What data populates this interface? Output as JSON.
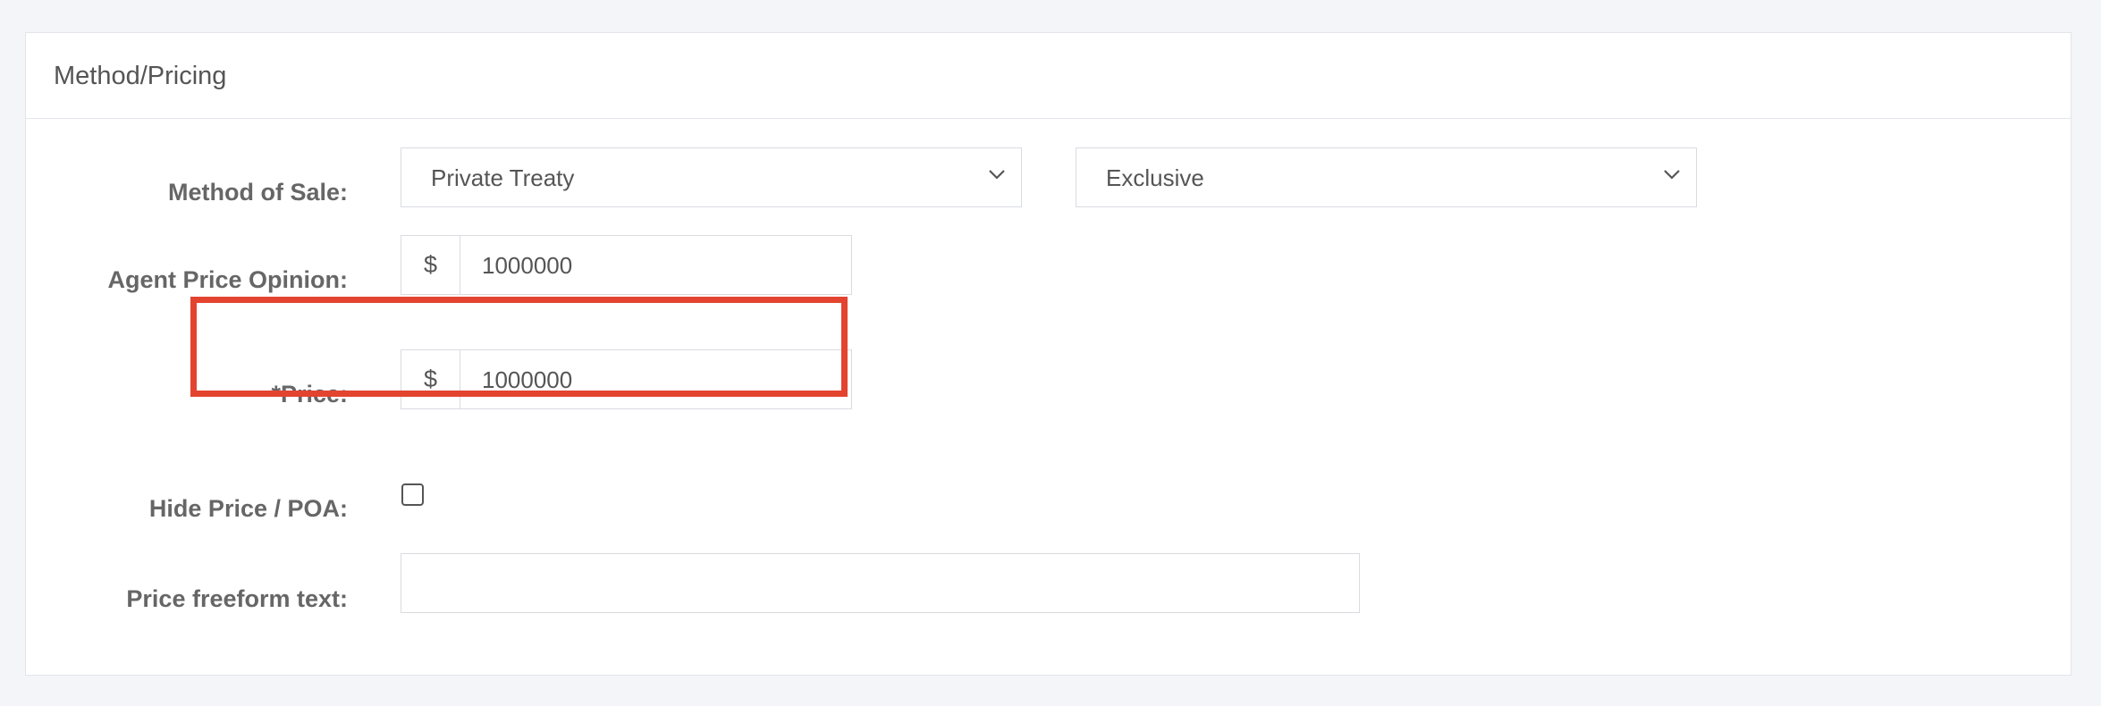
{
  "panel": {
    "title": "Method/Pricing"
  },
  "method_of_sale": {
    "label": "Method of Sale:",
    "method_value": "Private Treaty",
    "authority_value": "Exclusive"
  },
  "agent_price_opinion": {
    "label": "Agent Price Opinion:",
    "currency_symbol": "$",
    "value": "1000000"
  },
  "price": {
    "label": "*Price:",
    "currency_symbol": "$",
    "value": "1000000"
  },
  "hide_price": {
    "label": "Hide Price / POA:",
    "checked": false
  },
  "price_freeform": {
    "label": "Price freeform text:",
    "value": ""
  },
  "colors": {
    "highlight": "#e34430",
    "border": "#d9dbe0",
    "background": "#f4f5f9"
  },
  "icons": {
    "dropdown": "chevron-down-icon"
  }
}
